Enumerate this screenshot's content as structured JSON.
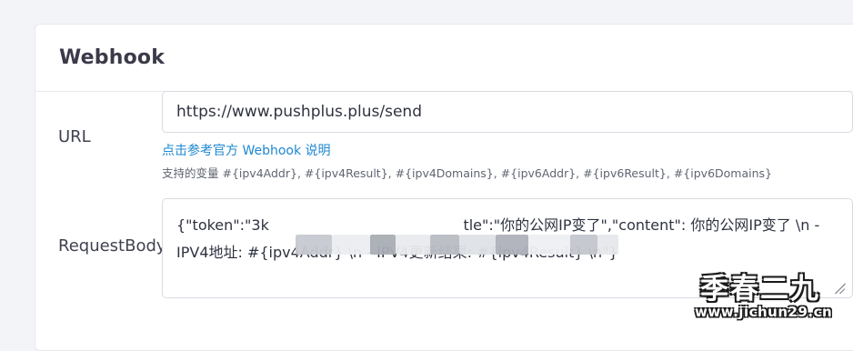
{
  "card": {
    "title": "Webhook"
  },
  "url_field": {
    "label": "URL",
    "value": "https://www.pushplus.plus/send"
  },
  "help": {
    "link": "点击参考官方 Webhook 说明",
    "variables": "支持的变量 #{ipv4Addr}, #{ipv4Result}, #{ipv4Domains}, #{ipv6Addr}, #{ipv6Result}, #{ipv6Domains}"
  },
  "request_body": {
    "label": "RequestBody",
    "value": "{\"token\":\"3k                                          tle\":\"你的公网IP变了\",\"content\": 你的公网IP变了 \\n - IPV4地址: #{ipv4Addr} \\n - IPV4更新结果: #{ipv4Result} \\n\"}"
  },
  "watermark": {
    "main": "季春二九",
    "url": "www.jichun29.cn"
  },
  "colors": {
    "background": "#f3f4f7",
    "card": "#ffffff",
    "link": "#1e88d0",
    "label": "#3f4250",
    "title": "#3b3a49"
  }
}
